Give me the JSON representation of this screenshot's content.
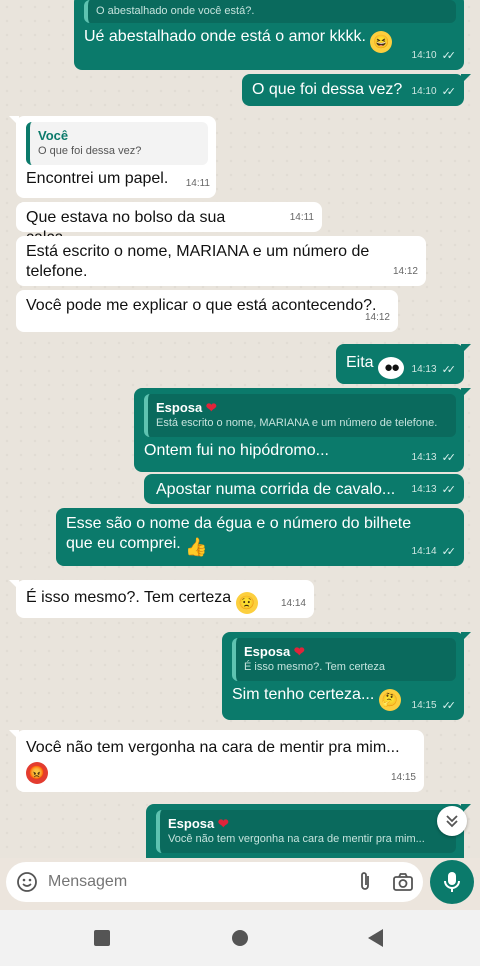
{
  "messages": [
    {
      "quote_text": "O abestalhado onde você está?.",
      "text": "Ué abestalhado onde está o amor kkkk.",
      "emoji": "laugh-emoji",
      "time": "14:10"
    },
    {
      "text": "O que foi dessa vez?",
      "time": "14:10"
    },
    {
      "quote_author": "Você",
      "quote_text": "O que foi dessa vez?",
      "text": "Encontrei um papel.",
      "time": "14:11"
    },
    {
      "text": "Que estava no bolso da sua calça",
      "time": "14:11"
    },
    {
      "text": "Está escrito o nome, MARIANA e um número de telefone.",
      "time": "14:12"
    },
    {
      "text": "Você pode me explicar o que está acontecendo?.",
      "time": "14:12"
    },
    {
      "text": "Eita",
      "emoji": "eyes-emoji",
      "time": "14:13"
    },
    {
      "quote_author": "Esposa",
      "quote_text": "Está escrito o nome, MARIANA e um número de telefone.",
      "text": "Ontem fui no hipódromo...",
      "time": "14:13"
    },
    {
      "text": "Apostar numa corrida de cavalo...",
      "time": "14:13"
    },
    {
      "text": "Esse são o nome da égua e o número do bilhete que eu comprei.",
      "emoji": "thumbs-up-emoji",
      "time": "14:14"
    },
    {
      "text": "É isso mesmo?. Tem certeza",
      "emoji": "worried-emoji",
      "time": "14:14"
    },
    {
      "quote_author": "Esposa",
      "quote_text": "É isso mesmo?. Tem certeza",
      "text": "Sim tenho certeza...",
      "emoji": "thinking-emoji",
      "time": "14:15"
    },
    {
      "text": "Você não tem vergonha na cara de mentir pra mim...",
      "emoji": "angry-emoji",
      "time": "14:15"
    },
    {
      "quote_author": "Esposa",
      "quote_text": "Você não tem vergonha na cara de mentir pra mim..."
    }
  ],
  "input": {
    "placeholder": "Mensagem"
  },
  "colors": {
    "outgoing_bubble": "#0b7a6b",
    "incoming_bubble": "#ffffff",
    "accent": "#0b7a6b"
  }
}
